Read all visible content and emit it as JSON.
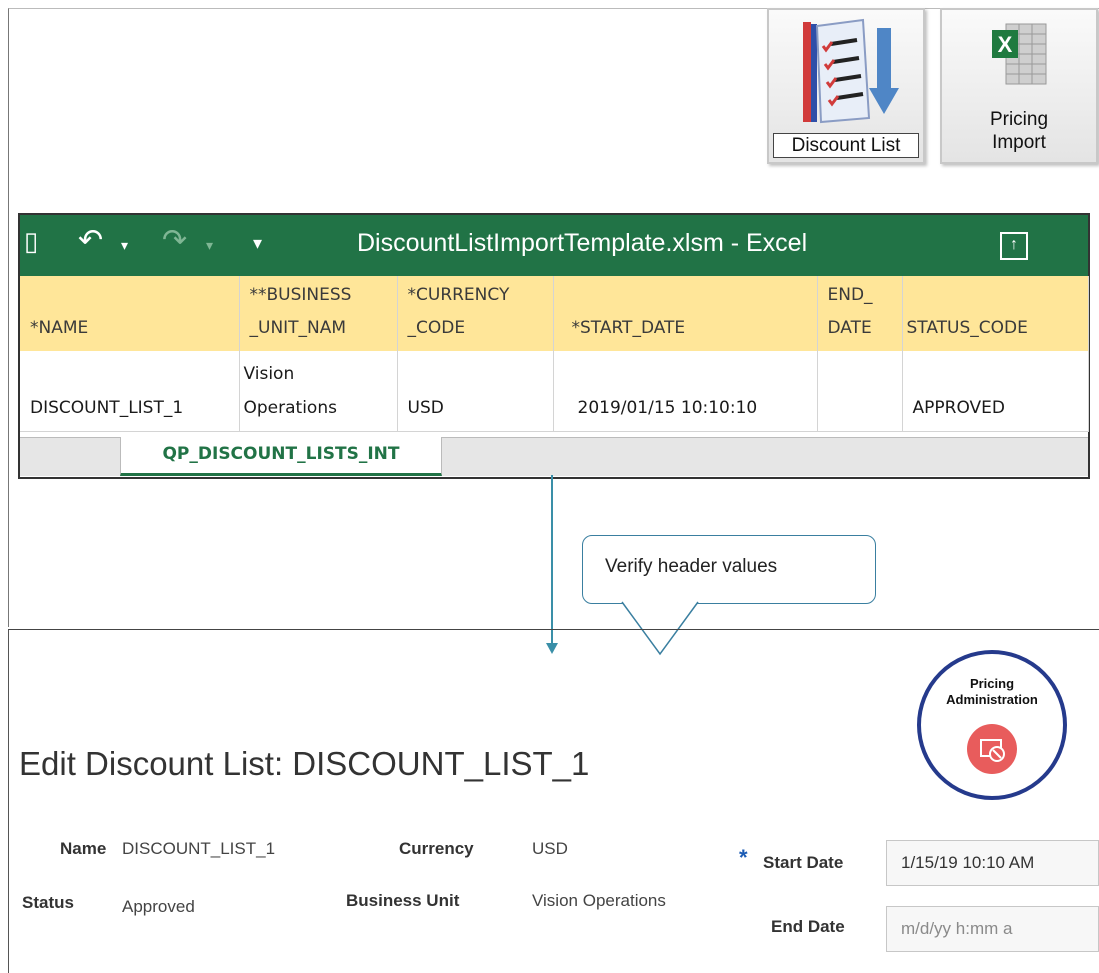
{
  "tiles": [
    {
      "label": "Discount List"
    },
    {
      "label_line1": "Pricing",
      "label_line2": "Import"
    }
  ],
  "excel": {
    "title": "DiscountListImportTemplate.xlsm  -  Excel",
    "headers": [
      {
        "line1": "",
        "line2": "*NAME"
      },
      {
        "line1": "**BUSINESS",
        "line2": "_UNIT_NAM"
      },
      {
        "line1": "*CURRENCY",
        "line2": "_CODE"
      },
      {
        "line1": "",
        "line2": "*START_DATE"
      },
      {
        "line1": "END_",
        "line2": "DATE"
      },
      {
        "line1": "",
        "line2": "STATUS_CODE"
      }
    ],
    "row": [
      {
        "line1": "",
        "line2": "DISCOUNT_LIST_1"
      },
      {
        "line1": "Vision",
        "line2": "Operations"
      },
      {
        "line1": "",
        "line2": "USD"
      },
      {
        "line1": "",
        "line2": "2019/01/15 10:10:10"
      },
      {
        "line1": "",
        "line2": ""
      },
      {
        "line1": "",
        "line2": "APPROVED"
      }
    ],
    "sheet_tab": "QP_DISCOUNT_LISTS_INT",
    "icons": [
      "save-icon",
      "undo-icon",
      "redo-icon",
      "customize-icon",
      "ribbon-display-icon"
    ],
    "accent_color": "#217346"
  },
  "callout": {
    "text": "Verify header values"
  },
  "badge": {
    "line1": "Pricing",
    "line2": "Administration",
    "color": "#253a8c",
    "icon_color": "#e85c5c"
  },
  "edit": {
    "title": "Edit Discount List: DISCOUNT_LIST_1",
    "name_label": "Name",
    "name_value": "DISCOUNT_LIST_1",
    "currency_label": "Currency",
    "currency_value": "USD",
    "status_label": "Status",
    "status_value": "Approved",
    "bu_label": "Business Unit",
    "bu_value": "Vision Operations",
    "start_label": "Start Date",
    "start_value": "1/15/19 10:10 AM",
    "end_label": "End Date",
    "end_placeholder": "m/d/yy h:mm a",
    "required_marker": "*"
  }
}
